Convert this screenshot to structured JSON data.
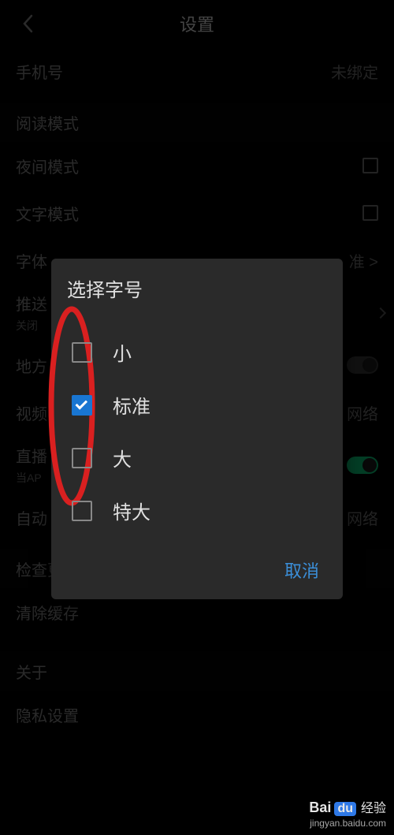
{
  "header": {
    "title": "设置"
  },
  "rows": {
    "phone": {
      "label": "手机号",
      "value": "未绑定"
    },
    "readMode": {
      "label": "阅读模式"
    },
    "nightMode": {
      "label": "夜间模式"
    },
    "textMode": {
      "label": "文字模式"
    },
    "fontSize": {
      "label": "字体"
    },
    "push": {
      "label": "推送",
      "sub": "关闭"
    },
    "region": {
      "label": "地方"
    },
    "video": {
      "label": "视频",
      "value": "网络"
    },
    "live": {
      "label": "直播",
      "sub": "当AP"
    },
    "auto": {
      "label": "自动",
      "value": "网络"
    },
    "checkUpdate": {
      "label": "检查更新"
    },
    "clearCache": {
      "label": "清除缓存"
    },
    "about": {
      "label": "关于"
    },
    "privacy": {
      "label": "隐私设置"
    }
  },
  "modal": {
    "title": "选择字号",
    "options": [
      {
        "label": "小",
        "checked": false
      },
      {
        "label": "标准",
        "checked": true
      },
      {
        "label": "大",
        "checked": false
      },
      {
        "label": "特大",
        "checked": false
      }
    ],
    "cancel": "取消"
  },
  "watermark": {
    "bai": "Bai",
    "du": "du",
    "jingyan": "经验",
    "url": "jingyan.baidu.com"
  }
}
